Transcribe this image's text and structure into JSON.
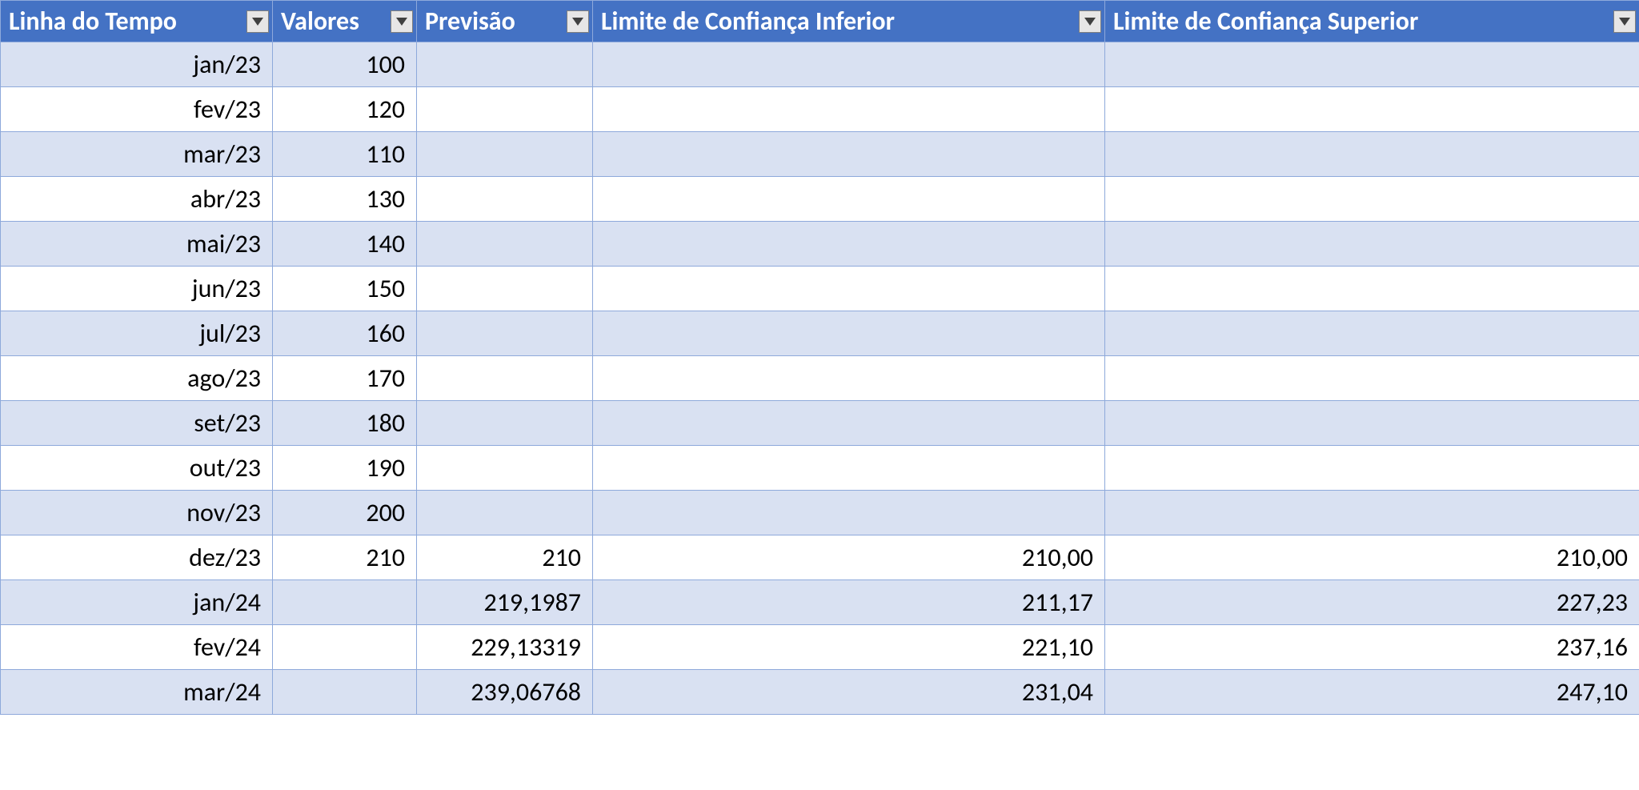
{
  "headers": [
    "Linha do Tempo",
    "Valores",
    "Previsão",
    "Limite de Confiança Inferior",
    "Limite de Confiança Superior"
  ],
  "rows": [
    {
      "t": "jan/23",
      "v": "100",
      "p": "",
      "li": "",
      "ls": ""
    },
    {
      "t": "fev/23",
      "v": "120",
      "p": "",
      "li": "",
      "ls": ""
    },
    {
      "t": "mar/23",
      "v": "110",
      "p": "",
      "li": "",
      "ls": ""
    },
    {
      "t": "abr/23",
      "v": "130",
      "p": "",
      "li": "",
      "ls": ""
    },
    {
      "t": "mai/23",
      "v": "140",
      "p": "",
      "li": "",
      "ls": ""
    },
    {
      "t": "jun/23",
      "v": "150",
      "p": "",
      "li": "",
      "ls": ""
    },
    {
      "t": "jul/23",
      "v": "160",
      "p": "",
      "li": "",
      "ls": ""
    },
    {
      "t": "ago/23",
      "v": "170",
      "p": "",
      "li": "",
      "ls": ""
    },
    {
      "t": "set/23",
      "v": "180",
      "p": "",
      "li": "",
      "ls": ""
    },
    {
      "t": "out/23",
      "v": "190",
      "p": "",
      "li": "",
      "ls": ""
    },
    {
      "t": "nov/23",
      "v": "200",
      "p": "",
      "li": "",
      "ls": ""
    },
    {
      "t": "dez/23",
      "v": "210",
      "p": "210",
      "li": "210,00",
      "ls": "210,00"
    },
    {
      "t": "jan/24",
      "v": "",
      "p": "219,1987",
      "li": "211,17",
      "ls": "227,23"
    },
    {
      "t": "fev/24",
      "v": "",
      "p": "229,13319",
      "li": "221,10",
      "ls": "237,16"
    },
    {
      "t": "mar/24",
      "v": "",
      "p": "239,06768",
      "li": "231,04",
      "ls": "247,10"
    }
  ]
}
